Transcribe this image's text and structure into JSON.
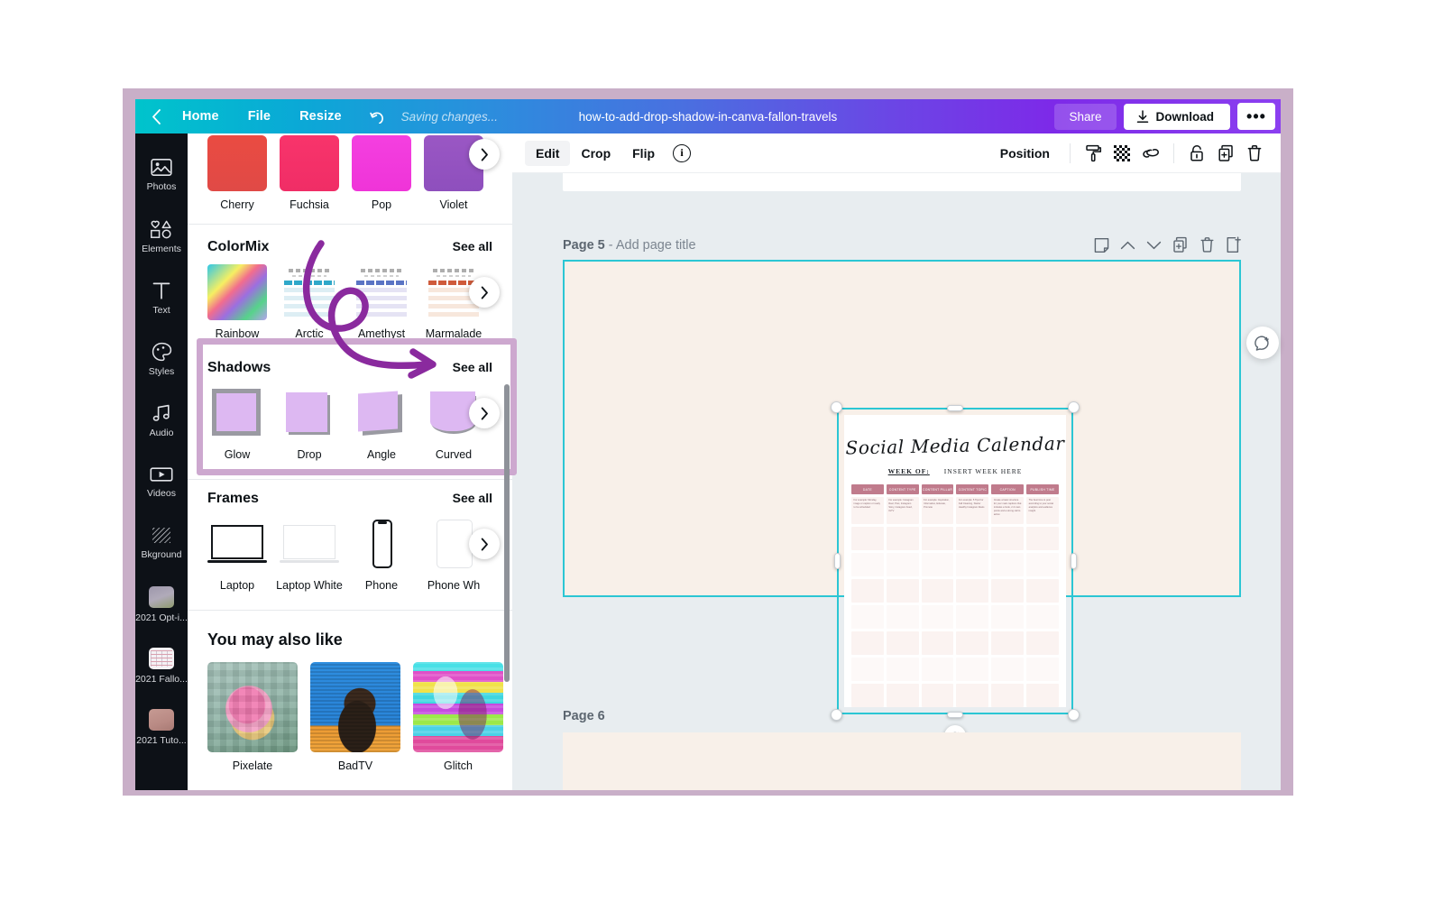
{
  "app": {
    "top_bar": {
      "back_icon": "chevron-left-icon",
      "home_label": "Home",
      "file_label": "File",
      "resize_label": "Resize",
      "undo_icon": "undo-arrow-icon",
      "saving_status": "Saving changes...",
      "document_title": "how-to-add-drop-shadow-in-canva-fallon-travels",
      "share_label": "Share",
      "download_label": "Download",
      "download_icon": "download-arrow-icon",
      "more_label": "•••",
      "gradient_start": "#00c4cc",
      "gradient_end": "#8b3ff0"
    }
  },
  "rail": {
    "items": [
      {
        "label": "Photos",
        "icon": "photo-icon"
      },
      {
        "label": "Elements",
        "icon": "shapes-icon"
      },
      {
        "label": "Text",
        "icon": "text-t-icon"
      },
      {
        "label": "Styles",
        "icon": "palette-icon"
      },
      {
        "label": "Audio",
        "icon": "music-note-icon"
      },
      {
        "label": "Videos",
        "icon": "video-play-icon"
      },
      {
        "label": "Bkground",
        "icon": "hatch-pattern-icon"
      },
      {
        "label": "2021 Opt-i...",
        "icon": "folder-thumb-optin"
      },
      {
        "label": "2021 Fallo...",
        "icon": "folder-thumb-fallon"
      },
      {
        "label": "2021 Tuto...",
        "icon": "folder-thumb-tutorial"
      }
    ]
  },
  "panel": {
    "colors_row": {
      "items": [
        {
          "label": "Cherry"
        },
        {
          "label": "Fuchsia"
        },
        {
          "label": "Pop"
        },
        {
          "label": "Violet"
        }
      ],
      "next_icon": "chevron-right-icon"
    },
    "colormix": {
      "title": "ColorMix",
      "see_all": "See all",
      "items": [
        {
          "label": "Rainbow"
        },
        {
          "label": "Arctic"
        },
        {
          "label": "Amethyst"
        },
        {
          "label": "Marmalade"
        }
      ],
      "next_icon": "chevron-right-icon"
    },
    "shadows": {
      "title": "Shadows",
      "see_all": "See all",
      "highlighted": true,
      "highlight_color": "#cda8cf",
      "items": [
        {
          "label": "Glow"
        },
        {
          "label": "Drop"
        },
        {
          "label": "Angle"
        },
        {
          "label": "Curved"
        }
      ],
      "next_icon": "chevron-right-icon"
    },
    "frames": {
      "title": "Frames",
      "see_all": "See all",
      "items": [
        {
          "label": "Laptop"
        },
        {
          "label": "Laptop White"
        },
        {
          "label": "Phone"
        },
        {
          "label": "Phone Wh"
        }
      ],
      "next_icon": "chevron-right-icon"
    },
    "you_may_also_like": {
      "title": "You may also like",
      "items": [
        {
          "label": "Pixelate"
        },
        {
          "label": "BadTV"
        },
        {
          "label": "Glitch"
        }
      ]
    },
    "annotation": {
      "type": "hand-drawn-arrow",
      "color": "#8a2a9e",
      "points_to": "Shadows See all"
    }
  },
  "editor_toolbar": {
    "edit_label": "Edit",
    "crop_label": "Crop",
    "flip_label": "Flip",
    "info_label": "i",
    "position_label": "Position",
    "icons": [
      {
        "name": "paint-roller-icon"
      },
      {
        "name": "transparency-checker-icon"
      },
      {
        "name": "link-icon"
      },
      {
        "name": "lock-icon"
      },
      {
        "name": "duplicate-icon"
      },
      {
        "name": "trash-icon"
      }
    ]
  },
  "canvas": {
    "page5": {
      "label": "Page 5",
      "title_placeholder": "- Add page title",
      "background": "#f8f0e9",
      "selection_color": "#2bc6d4",
      "icons": [
        {
          "name": "note-icon"
        },
        {
          "name": "chevron-up-icon"
        },
        {
          "name": "chevron-down-icon"
        },
        {
          "name": "duplicate-page-icon"
        },
        {
          "name": "delete-page-icon"
        },
        {
          "name": "add-page-icon"
        }
      ]
    },
    "page6": {
      "label": "Page 6"
    },
    "rotate_icon": "rotate-handle-icon",
    "comment_icon": "add-comment-icon"
  },
  "document": {
    "title": "Social Media Calendar",
    "week_of_label": "WEEK OF:",
    "week_value": "INSERT WEEK HERE",
    "table_headers": [
      "DATE",
      "CONTENT TYPE",
      "CONTENT PILLAR",
      "CONTENT TOPIC",
      "CAPTION",
      "PUBLISH TIME"
    ],
    "first_row": [
      "For example: Monday, image or caption or ready to be scheduled",
      "For example: Instagram Reel, Post, Instagram Story, Instagram Feed, IGTV",
      "For example: Inspiration, Informative, Educate, Promote",
      "For example: 5 Tips For Fall Cleaning, Starter Healthy Instagram Reels",
      "Create a basic structure for your main captions that includes a hook, 2-3 main points and a strong call to action",
      "The best time to post according to your social analytics and audience insight"
    ],
    "header_color": "#c07b8c",
    "cell_color": "#fbf3f1"
  }
}
